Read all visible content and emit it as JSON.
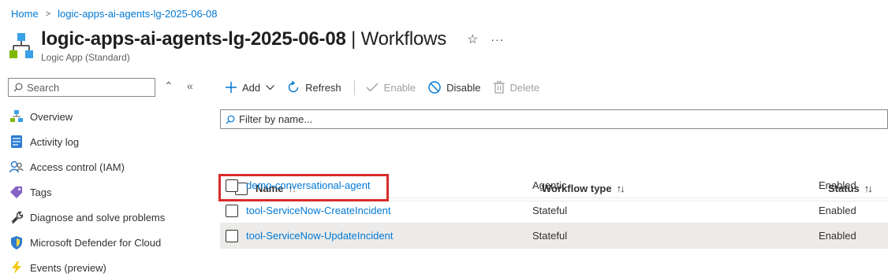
{
  "breadcrumb": {
    "home": "Home",
    "current": "logic-apps-ai-agents-lg-2025-06-08"
  },
  "header": {
    "title": "logic-apps-ai-agents-lg-2025-06-08",
    "title_suffix": " | Workflows",
    "subtitle": "Logic App (Standard)",
    "star_icon": "☆",
    "more_icon": "···"
  },
  "search": {
    "placeholder": "Search"
  },
  "sidebar": {
    "items": [
      {
        "label": "Overview",
        "icon": "overview-icon"
      },
      {
        "label": "Activity log",
        "icon": "activity-log-icon"
      },
      {
        "label": "Access control (IAM)",
        "icon": "iam-icon"
      },
      {
        "label": "Tags",
        "icon": "tag-icon"
      },
      {
        "label": "Diagnose and solve problems",
        "icon": "wrench-icon"
      },
      {
        "label": "Microsoft Defender for Cloud",
        "icon": "shield-icon"
      },
      {
        "label": "Events (preview)",
        "icon": "lightning-icon"
      }
    ]
  },
  "toolbar": {
    "add": "Add",
    "refresh": "Refresh",
    "enable": "Enable",
    "disable": "Disable",
    "delete": "Delete"
  },
  "filter": {
    "placeholder": "Filter by name..."
  },
  "table": {
    "columns": {
      "name": "Name",
      "type": "Workflow type",
      "status": "Status"
    },
    "rows": [
      {
        "name": "demo-conversational-agent",
        "type": "Agentic",
        "status": "Enabled"
      },
      {
        "name": "tool-ServiceNow-CreateIncident",
        "type": "Stateful",
        "status": "Enabled"
      },
      {
        "name": "tool-ServiceNow-UpdateIncident",
        "type": "Stateful",
        "status": "Enabled"
      }
    ]
  },
  "colors": {
    "accent": "#0078d4",
    "highlight": "#d92b2b"
  }
}
